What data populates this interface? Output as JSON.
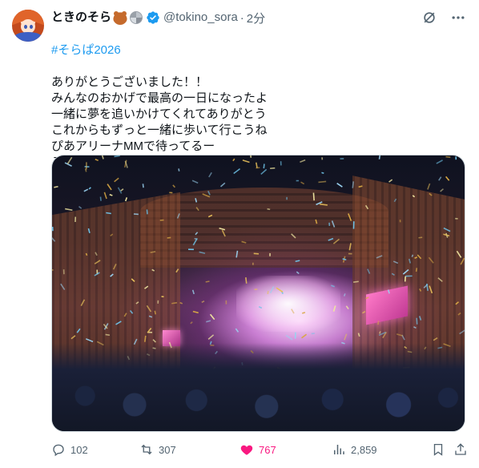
{
  "post": {
    "display_name": "ときのそら",
    "handle": "@tokino_sora",
    "separator": "·",
    "time": "2分",
    "hashtag": "#そらぱ2026",
    "text": "ありがとうございました！！\nみんなのおかげで最高の一日になったよ\n一緒に夢を追いかけてくれてありがとう\nこれからもずっと一緒に歩いて行こうね\nぴあアリーナMMで待ってるー\nみんなはわたしの宝物だよ"
  },
  "icons": {
    "verified": "verified-badge-icon",
    "grok": "grok-icon",
    "more": "more-icon",
    "reply": "reply-icon",
    "repost": "repost-icon",
    "like": "like-heart-icon",
    "views": "views-icon",
    "bookmark": "bookmark-icon",
    "share": "share-icon"
  },
  "actions": {
    "reply_count": "102",
    "repost_count": "307",
    "like_count": "767",
    "views_count": "2,859"
  },
  "colors": {
    "accent": "#1d9bf0",
    "like": "#f91880",
    "muted": "#536471",
    "text": "#0f1419"
  }
}
